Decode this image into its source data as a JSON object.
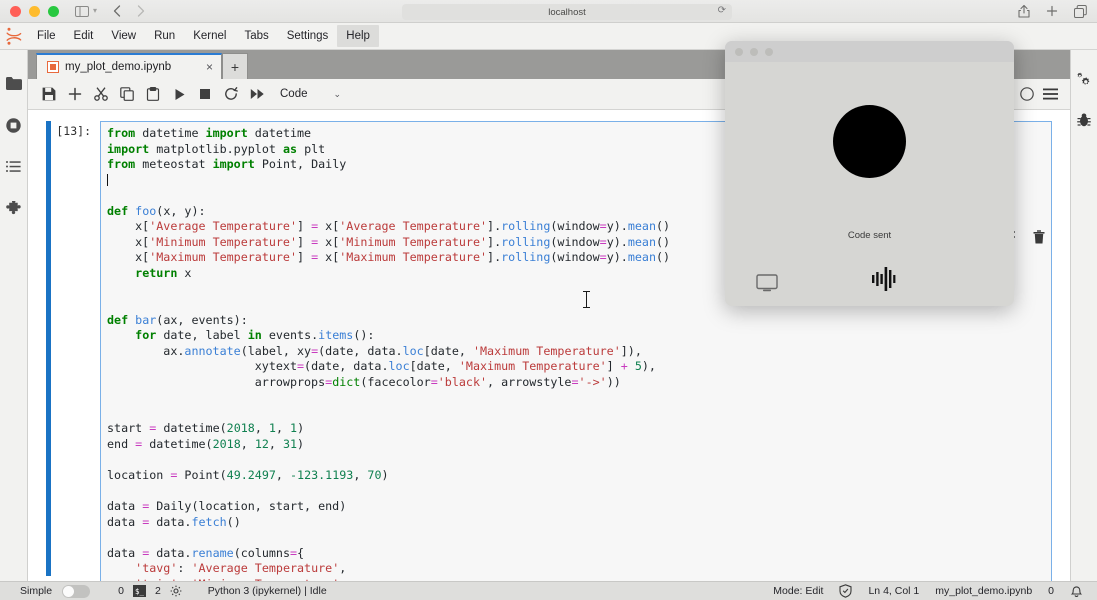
{
  "browser": {
    "url": "localhost",
    "icons": {
      "sidebar": "sidebar-toggle-icon",
      "chevron": "chevron-down-icon",
      "back": "back-arrow-icon",
      "forward": "forward-arrow-icon",
      "reload": "reload-icon",
      "share": "share-icon",
      "new_tab": "plus-icon",
      "tabs_overview": "tabs-overview-icon"
    }
  },
  "menubar": {
    "items": [
      {
        "label": "File",
        "active": false
      },
      {
        "label": "Edit",
        "active": false
      },
      {
        "label": "View",
        "active": false
      },
      {
        "label": "Run",
        "active": false
      },
      {
        "label": "Kernel",
        "active": false
      },
      {
        "label": "Tabs",
        "active": false
      },
      {
        "label": "Settings",
        "active": false
      },
      {
        "label": "Help",
        "active": true
      }
    ]
  },
  "left_sidebar": {
    "items": [
      {
        "name": "file-browser",
        "icon": "folder-icon"
      },
      {
        "name": "running-terminals",
        "icon": "stop-circle-icon"
      },
      {
        "name": "table-of-contents",
        "icon": "list-icon"
      },
      {
        "name": "extension-manager",
        "icon": "puzzle-icon"
      }
    ]
  },
  "right_sidebar": {
    "items": [
      {
        "name": "property-inspector",
        "icon": "gears-icon"
      },
      {
        "name": "debugger",
        "icon": "bug-icon"
      }
    ]
  },
  "notebook": {
    "tab": {
      "title": "my_plot_demo.ipynb",
      "close": "×"
    },
    "add_tab": "+",
    "toolbar": {
      "save": "save-icon",
      "insert": "plus-icon",
      "cut": "scissors-icon",
      "copy": "copy-icon",
      "paste": "paste-icon",
      "run": "run-icon",
      "stop": "stop-icon",
      "restart": "restart-icon",
      "restart_run_all": "fast-forward-icon",
      "celltype_value": "Code",
      "celltype_chevron": "⌄",
      "kernel_status": "kernel-idle-icon",
      "kernel_circle": "kernel-circle-icon",
      "menu": "hamburger-menu-icon"
    },
    "cell": {
      "prompt": "[13]:",
      "toolbar": {
        "duplicate": "move-cell-icon",
        "delete": "trash-icon"
      },
      "code_lines": [
        [
          {
            "t": "from ",
            "c": "k"
          },
          {
            "t": "datetime ",
            "c": "pl"
          },
          {
            "t": "import ",
            "c": "k"
          },
          {
            "t": "datetime",
            "c": "pl"
          }
        ],
        [
          {
            "t": "import ",
            "c": "k"
          },
          {
            "t": "matplotlib.pyplot ",
            "c": "pl"
          },
          {
            "t": "as ",
            "c": "k"
          },
          {
            "t": "plt",
            "c": "pl"
          }
        ],
        [
          {
            "t": "from ",
            "c": "k"
          },
          {
            "t": "meteostat ",
            "c": "pl"
          },
          {
            "t": "import ",
            "c": "k"
          },
          {
            "t": "Point, Daily",
            "c": "pl"
          }
        ],
        [
          {
            "t": "__CURSOR__",
            "c": "cur"
          }
        ],
        [],
        [
          {
            "t": "def ",
            "c": "k"
          },
          {
            "t": "foo",
            "c": "fn"
          },
          {
            "t": "(x, y):",
            "c": "pl"
          }
        ],
        [
          {
            "t": "    x[",
            "c": "pl"
          },
          {
            "t": "'Average Temperature'",
            "c": "st"
          },
          {
            "t": "] ",
            "c": "pl"
          },
          {
            "t": "=",
            "c": "op"
          },
          {
            "t": " x[",
            "c": "pl"
          },
          {
            "t": "'Average Temperature'",
            "c": "st"
          },
          {
            "t": "].",
            "c": "pl"
          },
          {
            "t": "rolling",
            "c": "fn"
          },
          {
            "t": "(window",
            "c": "pl"
          },
          {
            "t": "=",
            "c": "op"
          },
          {
            "t": "y).",
            "c": "pl"
          },
          {
            "t": "mean",
            "c": "fn"
          },
          {
            "t": "()",
            "c": "pl"
          }
        ],
        [
          {
            "t": "    x[",
            "c": "pl"
          },
          {
            "t": "'Minimum Temperature'",
            "c": "st"
          },
          {
            "t": "] ",
            "c": "pl"
          },
          {
            "t": "=",
            "c": "op"
          },
          {
            "t": " x[",
            "c": "pl"
          },
          {
            "t": "'Minimum Temperature'",
            "c": "st"
          },
          {
            "t": "].",
            "c": "pl"
          },
          {
            "t": "rolling",
            "c": "fn"
          },
          {
            "t": "(window",
            "c": "pl"
          },
          {
            "t": "=",
            "c": "op"
          },
          {
            "t": "y).",
            "c": "pl"
          },
          {
            "t": "mean",
            "c": "fn"
          },
          {
            "t": "()",
            "c": "pl"
          }
        ],
        [
          {
            "t": "    x[",
            "c": "pl"
          },
          {
            "t": "'Maximum Temperature'",
            "c": "st"
          },
          {
            "t": "] ",
            "c": "pl"
          },
          {
            "t": "=",
            "c": "op"
          },
          {
            "t": " x[",
            "c": "pl"
          },
          {
            "t": "'Maximum Temperature'",
            "c": "st"
          },
          {
            "t": "].",
            "c": "pl"
          },
          {
            "t": "rolling",
            "c": "fn"
          },
          {
            "t": "(window",
            "c": "pl"
          },
          {
            "t": "=",
            "c": "op"
          },
          {
            "t": "y).",
            "c": "pl"
          },
          {
            "t": "mean",
            "c": "fn"
          },
          {
            "t": "()",
            "c": "pl"
          }
        ],
        [
          {
            "t": "    ",
            "c": "pl"
          },
          {
            "t": "return ",
            "c": "k"
          },
          {
            "t": "x",
            "c": "pl"
          }
        ],
        [],
        [],
        [
          {
            "t": "def ",
            "c": "k"
          },
          {
            "t": "bar",
            "c": "fn"
          },
          {
            "t": "(ax, events):",
            "c": "pl"
          }
        ],
        [
          {
            "t": "    ",
            "c": "pl"
          },
          {
            "t": "for ",
            "c": "k"
          },
          {
            "t": "date, label ",
            "c": "pl"
          },
          {
            "t": "in ",
            "c": "k"
          },
          {
            "t": "events.",
            "c": "pl"
          },
          {
            "t": "items",
            "c": "fn"
          },
          {
            "t": "():",
            "c": "pl"
          }
        ],
        [
          {
            "t": "        ax.",
            "c": "pl"
          },
          {
            "t": "annotate",
            "c": "fn"
          },
          {
            "t": "(label, xy",
            "c": "pl"
          },
          {
            "t": "=",
            "c": "op"
          },
          {
            "t": "(date, data.",
            "c": "pl"
          },
          {
            "t": "loc",
            "c": "fn"
          },
          {
            "t": "[date, ",
            "c": "pl"
          },
          {
            "t": "'Maximum Temperature'",
            "c": "st"
          },
          {
            "t": "]),",
            "c": "pl"
          }
        ],
        [
          {
            "t": "                     xytext",
            "c": "pl"
          },
          {
            "t": "=",
            "c": "op"
          },
          {
            "t": "(date, data.",
            "c": "pl"
          },
          {
            "t": "loc",
            "c": "fn"
          },
          {
            "t": "[date, ",
            "c": "pl"
          },
          {
            "t": "'Maximum Temperature'",
            "c": "st"
          },
          {
            "t": "] ",
            "c": "pl"
          },
          {
            "t": "+ ",
            "c": "op"
          },
          {
            "t": "5",
            "c": "nu"
          },
          {
            "t": "),",
            "c": "pl"
          }
        ],
        [
          {
            "t": "                     arrowprops",
            "c": "pl"
          },
          {
            "t": "=",
            "c": "op"
          },
          {
            "t": "dict",
            "c": "bi"
          },
          {
            "t": "(facecolor",
            "c": "pl"
          },
          {
            "t": "=",
            "c": "op"
          },
          {
            "t": "'black'",
            "c": "st"
          },
          {
            "t": ", arrowstyle",
            "c": "pl"
          },
          {
            "t": "=",
            "c": "op"
          },
          {
            "t": "'->'",
            "c": "st"
          },
          {
            "t": "))",
            "c": "pl"
          }
        ],
        [],
        [],
        [
          {
            "t": "start ",
            "c": "pl"
          },
          {
            "t": "=",
            "c": "op"
          },
          {
            "t": " datetime(",
            "c": "pl"
          },
          {
            "t": "2018",
            "c": "nu"
          },
          {
            "t": ", ",
            "c": "pl"
          },
          {
            "t": "1",
            "c": "nu"
          },
          {
            "t": ", ",
            "c": "pl"
          },
          {
            "t": "1",
            "c": "nu"
          },
          {
            "t": ")",
            "c": "pl"
          }
        ],
        [
          {
            "t": "end ",
            "c": "pl"
          },
          {
            "t": "=",
            "c": "op"
          },
          {
            "t": " datetime(",
            "c": "pl"
          },
          {
            "t": "2018",
            "c": "nu"
          },
          {
            "t": ", ",
            "c": "pl"
          },
          {
            "t": "12",
            "c": "nu"
          },
          {
            "t": ", ",
            "c": "pl"
          },
          {
            "t": "31",
            "c": "nu"
          },
          {
            "t": ")",
            "c": "pl"
          }
        ],
        [],
        [
          {
            "t": "location ",
            "c": "pl"
          },
          {
            "t": "=",
            "c": "op"
          },
          {
            "t": " Point(",
            "c": "pl"
          },
          {
            "t": "49.2497",
            "c": "nu"
          },
          {
            "t": ", ",
            "c": "pl"
          },
          {
            "t": "-123.1193",
            "c": "nu"
          },
          {
            "t": ", ",
            "c": "pl"
          },
          {
            "t": "70",
            "c": "nu"
          },
          {
            "t": ")",
            "c": "pl"
          }
        ],
        [],
        [
          {
            "t": "data ",
            "c": "pl"
          },
          {
            "t": "=",
            "c": "op"
          },
          {
            "t": " Daily(location, start, end)",
            "c": "pl"
          }
        ],
        [
          {
            "t": "data ",
            "c": "pl"
          },
          {
            "t": "=",
            "c": "op"
          },
          {
            "t": " data.",
            "c": "pl"
          },
          {
            "t": "fetch",
            "c": "fn"
          },
          {
            "t": "()",
            "c": "pl"
          }
        ],
        [],
        [
          {
            "t": "data ",
            "c": "pl"
          },
          {
            "t": "=",
            "c": "op"
          },
          {
            "t": " data.",
            "c": "pl"
          },
          {
            "t": "rename",
            "c": "fn"
          },
          {
            "t": "(columns",
            "c": "pl"
          },
          {
            "t": "=",
            "c": "op"
          },
          {
            "t": "{",
            "c": "pl"
          }
        ],
        [
          {
            "t": "    ",
            "c": "pl"
          },
          {
            "t": "'tavg'",
            "c": "st"
          },
          {
            "t": ": ",
            "c": "pl"
          },
          {
            "t": "'Average Temperature'",
            "c": "st"
          },
          {
            "t": ",",
            "c": "pl"
          }
        ],
        [
          {
            "t": "    ",
            "c": "pl"
          },
          {
            "t": "'tmin'",
            "c": "st"
          },
          {
            "t": ": ",
            "c": "pl"
          },
          {
            "t": "'Minimum Temperature'",
            "c": "st"
          },
          {
            "t": ",",
            "c": "pl"
          }
        ]
      ]
    }
  },
  "popup": {
    "status_text": "Code sent",
    "circle": "record-indicator",
    "screen_icon": "screen-share-icon",
    "wave_icon": "audio-waveform-icon",
    "dots": [
      "close",
      "minimize",
      "maximize"
    ]
  },
  "statusbar": {
    "simple_label": "Simple",
    "simple_on": false,
    "kernel_count": "0",
    "terminal_glyph": "$_",
    "notebook_count": "2",
    "settings_icon": "gear-icon",
    "kernel_name": "Python 3 (ipykernel) | Idle",
    "mode": "Mode: Edit",
    "trust_icon": "shield-check-icon",
    "position": "Ln 4, Col 1",
    "filename": "my_plot_demo.ipynb",
    "notif_count": "0",
    "bell_icon": "bell-icon"
  },
  "colors": {
    "accent_blue": "#1a73c4",
    "tab_orange": "#e8693c",
    "chrome_bg": "#ececeb",
    "jp_bg": "#f2f2f0"
  }
}
